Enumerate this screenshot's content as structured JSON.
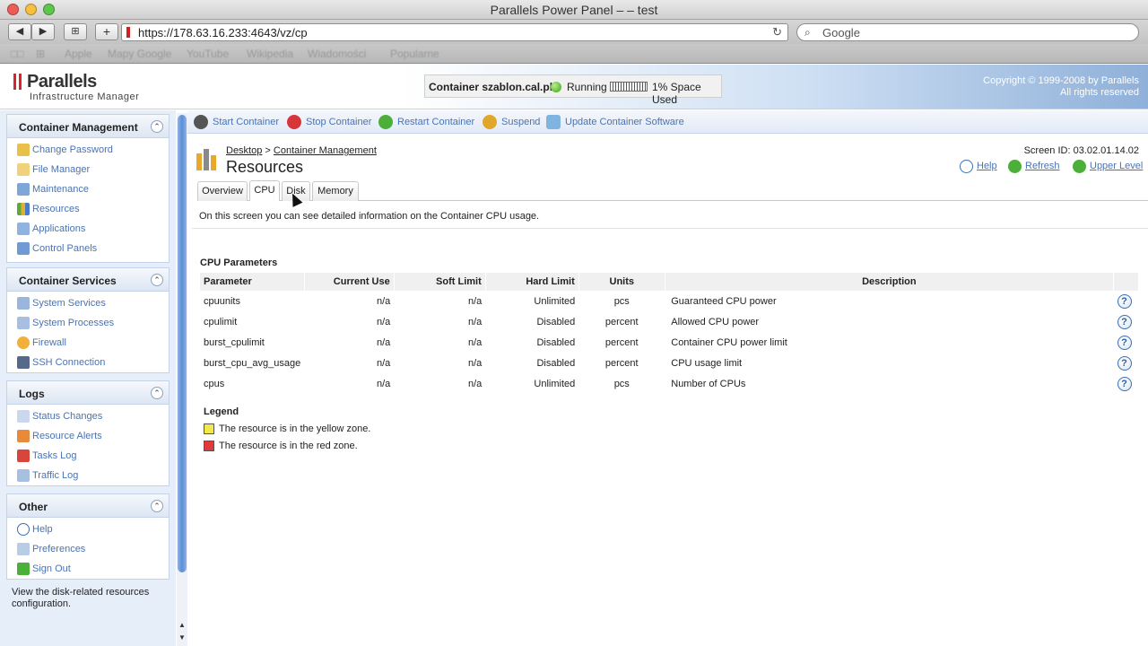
{
  "window": {
    "title": "Parallels Power Panel – – test"
  },
  "browser": {
    "back": "◀",
    "forward": "▶",
    "topsites": "⊞",
    "add": "+",
    "url": "https://178.63.16.233:4643/vz/cp",
    "reload": "↻",
    "search_placeholder": "Google",
    "search_icon": "⌕",
    "bookmarks": [
      "Apple",
      "Mapy Google",
      "YouTube",
      "Wikipedia",
      "Wiadomości",
      "Popularne"
    ]
  },
  "header": {
    "logo_name": "Parallels",
    "logo_sub": "Infrastructure Manager",
    "container_label": "Container szablon.cal.pl",
    "status": "Running",
    "space": "1% Space Used",
    "copyright_line1": "Copyright © 1999-2008 by Parallels",
    "copyright_line2": "All rights reserved"
  },
  "sidebar": {
    "panels": [
      {
        "title": "Container Management",
        "items": [
          "Change Password",
          "File Manager",
          "Maintenance",
          "Resources",
          "Applications",
          "Control Panels"
        ]
      },
      {
        "title": "Container Services",
        "items": [
          "System Services",
          "System Processes",
          "Firewall",
          "SSH Connection"
        ]
      },
      {
        "title": "Logs",
        "items": [
          "Status Changes",
          "Resource Alerts",
          "Tasks Log",
          "Traffic Log"
        ]
      },
      {
        "title": "Other",
        "items": [
          "Help",
          "Preferences",
          "Sign Out"
        ]
      }
    ],
    "hint": "View the disk-related resources configuration."
  },
  "actions": [
    "Start Container",
    "Stop Container",
    "Restart Container",
    "Suspend",
    "Update Container Software"
  ],
  "page": {
    "breadcrumb_desktop": "Desktop",
    "breadcrumb_sep": ">",
    "breadcrumb_cm": "Container Management",
    "title": "Resources",
    "screen_id": "Screen ID: 03.02.01.14.02",
    "links": {
      "help": "Help",
      "refresh": "Refresh",
      "upper": "Upper Level"
    },
    "tabs": [
      "Overview",
      "CPU",
      "Disk",
      "Memory"
    ],
    "active_tab": "CPU",
    "description": "On this screen you can see detailed information on the Container CPU usage."
  },
  "cpu_table": {
    "title": "CPU Parameters",
    "headers": [
      "Parameter",
      "Current Use",
      "Soft Limit",
      "Hard Limit",
      "Units",
      "Description"
    ],
    "rows": [
      [
        "cpuunits",
        "n/a",
        "n/a",
        "Unlimited",
        "pcs",
        "Guaranteed CPU power"
      ],
      [
        "cpulimit",
        "n/a",
        "n/a",
        "Disabled",
        "percent",
        "Allowed CPU power"
      ],
      [
        "burst_cpulimit",
        "n/a",
        "n/a",
        "Disabled",
        "percent",
        "Container CPU power limit"
      ],
      [
        "burst_cpu_avg_usage",
        "n/a",
        "n/a",
        "Disabled",
        "percent",
        "CPU usage limit"
      ],
      [
        "cpus",
        "n/a",
        "n/a",
        "Unlimited",
        "pcs",
        "Number of CPUs"
      ]
    ],
    "help_glyph": "?"
  },
  "legend": {
    "title": "Legend",
    "yellow": "The resource is in the yellow zone.",
    "red": "The resource is in the red zone.",
    "yellow_color": "#f2e84a",
    "red_color": "#e23a3a"
  },
  "colors": {
    "link": "#4a73b3",
    "accent": "#5b8ed6"
  }
}
